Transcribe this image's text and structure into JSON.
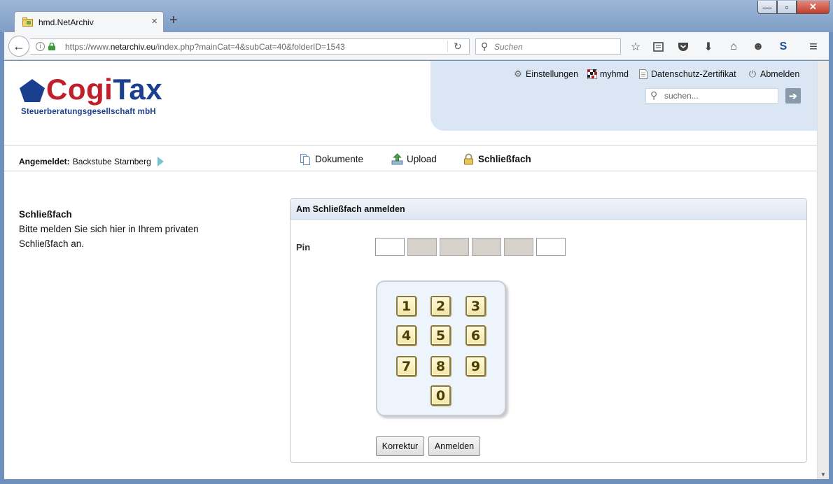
{
  "browser": {
    "tab_title": "hmd.NetArchiv",
    "tab_close": "×",
    "new_tab": "+",
    "back": "←",
    "url_prefix": "https://www.",
    "url_domain": "netarchiv.eu",
    "url_rest": "/index.php?mainCat=4&subCat=40&folderID=1543",
    "search_placeholder": "Suchen",
    "win_min": "—",
    "win_max": "▫",
    "win_close": "✕"
  },
  "logo": {
    "brand_part1": "Cogi",
    "brand_part2": "Tax",
    "tagline": "Steuerberatungsgesellschaft mbH"
  },
  "toplinks": {
    "settings": "Einstellungen",
    "myhmd": "myhmd",
    "privacy": "Datenschutz-Zertifikat",
    "logout": "Abmelden"
  },
  "site_search": {
    "placeholder": "suchen...",
    "go": "➔"
  },
  "nav": {
    "logged_in_label": "Angemeldet:",
    "logged_in_user": "Backstube Starnberg",
    "items": [
      {
        "label": "Dokumente"
      },
      {
        "label": "Upload"
      },
      {
        "label": "Schließfach"
      }
    ]
  },
  "left": {
    "heading": "Schließfach",
    "text": "Bitte melden Sie sich hier in Ihrem privaten Schließfach an."
  },
  "login_box": {
    "title": "Am Schließfach anmelden",
    "pin_label": "Pin",
    "pin_fields": [
      "empty",
      "filled",
      "filled",
      "filled",
      "filled",
      "empty"
    ],
    "keys": [
      "1",
      "2",
      "3",
      "4",
      "5",
      "6",
      "7",
      "8",
      "9",
      "0"
    ],
    "correction_label": "Korrektur",
    "login_label": "Anmelden"
  },
  "colors": {
    "brand_red": "#c0202a",
    "brand_blue": "#1b3f8f",
    "panel_blue": "#dbe6f4"
  }
}
